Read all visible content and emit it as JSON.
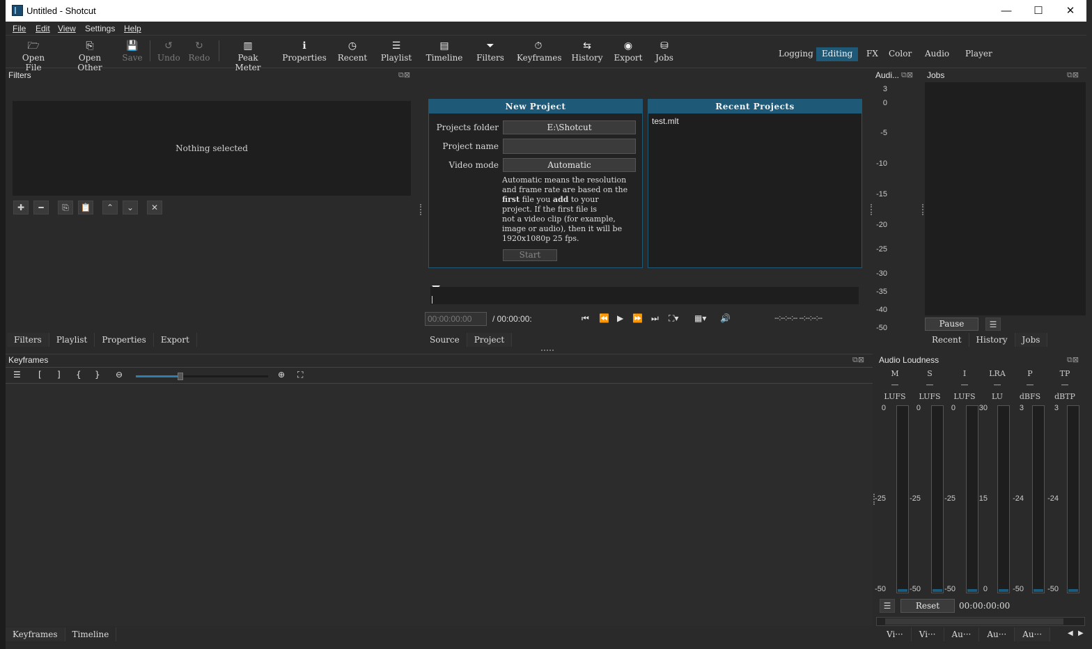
{
  "window": {
    "title": "Untitled - Shotcut",
    "minimize": "—",
    "maximize": "☐",
    "close": "✕"
  },
  "menu": [
    "File",
    "Edit",
    "View",
    "Settings",
    "Help"
  ],
  "toolbar": {
    "open_file": "Open File",
    "open_other": "Open Other",
    "save": "Save",
    "undo": "Undo",
    "redo": "Redo",
    "peak_meter": "Peak Meter",
    "properties": "Properties",
    "recent": "Recent",
    "playlist": "Playlist",
    "timeline": "Timeline",
    "filters": "Filters",
    "keyframes": "Keyframes",
    "history": "History",
    "export": "Export",
    "jobs": "Jobs"
  },
  "layouts": [
    "Logging",
    "Editing",
    "FX",
    "Color",
    "Audio",
    "Player"
  ],
  "layout_active": "Editing",
  "filters_panel": {
    "title": "Filters",
    "empty_text": "Nothing selected"
  },
  "left_tabs": [
    "Filters",
    "Playlist",
    "Properties",
    "Export"
  ],
  "new_project": {
    "header": "New Project",
    "folder_label": "Projects folder",
    "folder_value": "E:\\Shotcut",
    "name_label": "Project name",
    "name_value": "",
    "mode_label": "Video mode",
    "mode_value": "Automatic",
    "desc_1": "Automatic means the resolution",
    "desc_2": "and frame rate are based on the",
    "desc_3a": "first",
    "desc_3b": " file you ",
    "desc_3c": "add",
    "desc_3d": " to your",
    "desc_4": "project. If the first file is",
    "desc_5": "not a video clip (for example,",
    "desc_6": "image or audio), then it will be",
    "desc_7": "1920x1080p 25 fps.",
    "start": "Start"
  },
  "recent_projects": {
    "header": "Recent Projects",
    "items": [
      "test.mlt"
    ]
  },
  "player": {
    "timecode": "00:00:00:00",
    "duration": "/ 00:00:00:",
    "in_out": "--:--:--:-- --:--:--:--"
  },
  "center_tabs": [
    "Source",
    "Project"
  ],
  "audio_meter": {
    "title": "Audi...",
    "ticks": [
      "3",
      "0",
      "-5",
      "-10",
      "-15",
      "-20",
      "-25",
      "-30",
      "-35",
      "-40",
      "-50"
    ]
  },
  "jobs": {
    "title": "Jobs",
    "pause": "Pause"
  },
  "right_tabs": [
    "Recent",
    "History",
    "Jobs"
  ],
  "keyframes": {
    "title": "Keyframes"
  },
  "bottom_tabs": [
    "Keyframes",
    "Timeline"
  ],
  "loudness": {
    "title": "Audio Loudness",
    "meters": [
      {
        "name": "M",
        "unit": "LUFS",
        "top": "0",
        "mid": "-25",
        "bottom": "-50"
      },
      {
        "name": "S",
        "unit": "LUFS",
        "top": "0",
        "mid": "-25",
        "bottom": "-50"
      },
      {
        "name": "I",
        "unit": "LUFS",
        "top": "0",
        "mid": "-25",
        "bottom": "-50"
      },
      {
        "name": "LRA",
        "unit": "LU",
        "top": "30",
        "mid": "15",
        "bottom": "0"
      },
      {
        "name": "P",
        "unit": "dBFS",
        "top": "3",
        "mid": "-24",
        "bottom": "-50"
      },
      {
        "name": "TP",
        "unit": "dBTP",
        "top": "3",
        "mid": "-24",
        "bottom": "-50"
      }
    ],
    "dash": "—",
    "reset": "Reset",
    "time": "00:00:00:00"
  },
  "bottom_right_tabs": [
    "Vi···",
    "Vi···",
    "Au···",
    "Au···",
    "Au···"
  ],
  "colors": {
    "accent": "#1e5a78",
    "panel": "#2a2a2a",
    "dark": "#1e1e1e"
  }
}
